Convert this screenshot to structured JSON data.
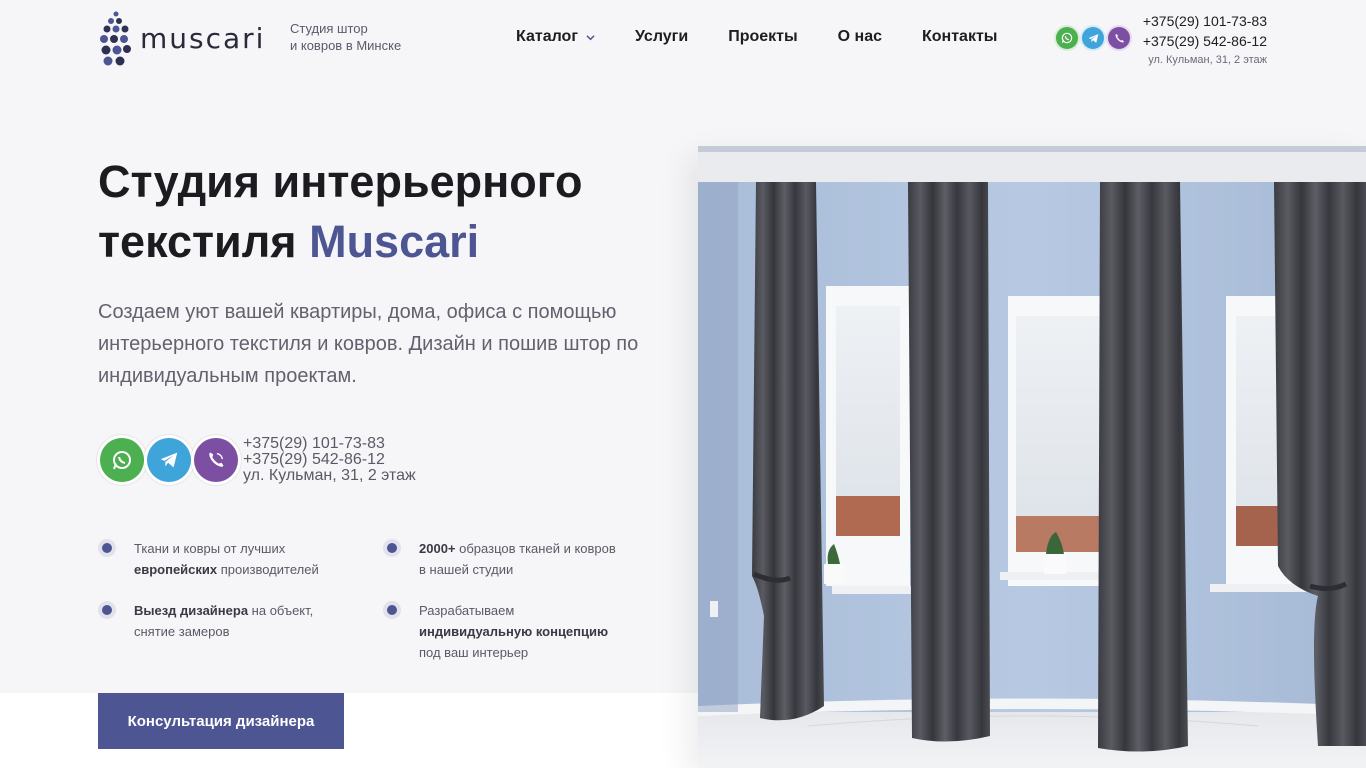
{
  "brand": {
    "name": "muscari",
    "tagline_line1": "Студия штор",
    "tagline_line2": "и ковров в Минске"
  },
  "nav": {
    "items": [
      {
        "label": "Каталог",
        "has_dropdown": true
      },
      {
        "label": "Услуги"
      },
      {
        "label": "Проекты"
      },
      {
        "label": "О нас"
      },
      {
        "label": "Контакты"
      }
    ]
  },
  "contacts": {
    "phone1": "+375(29) 101-73-83",
    "phone2": "+375(29) 542-86-12",
    "address": "ул. Кульман, 31, 2 этаж"
  },
  "messengers": [
    {
      "name": "whatsapp-icon",
      "color": "#4caf50"
    },
    {
      "name": "telegram-icon",
      "color": "#3ea4da"
    },
    {
      "name": "viber-icon",
      "color": "#7d4fa3"
    }
  ],
  "hero": {
    "title_part1": "Студия интерьерного",
    "title_part2": "текстиля ",
    "title_brand": "Muscari",
    "subtitle": "Создаем уют вашей квартиры, дома, офиса с помощью интерьерного текстиля и ковров. Дизайн и пошив штор по индивидуальным проектам."
  },
  "features": [
    {
      "pre": "Ткани и ковры от лучших ",
      "bold": "европейских",
      "post": " производителей"
    },
    {
      "pre": "",
      "bold": "2000+",
      "post": " образцов тканей и ковров в нашей студии"
    },
    {
      "pre": "",
      "bold": "Выезд дизайнера",
      "post": " на объект, снятие замеров"
    },
    {
      "pre": "Разрабатываем ",
      "bold": "индивидуальную концепцию",
      "post": " под ваш интерьер"
    }
  ],
  "cta": {
    "label": "Консультация дизайнера"
  },
  "colors": {
    "accent": "#4d5593",
    "text": "#1b1b20",
    "muted": "#62626e",
    "background": "#f6f6f9"
  }
}
